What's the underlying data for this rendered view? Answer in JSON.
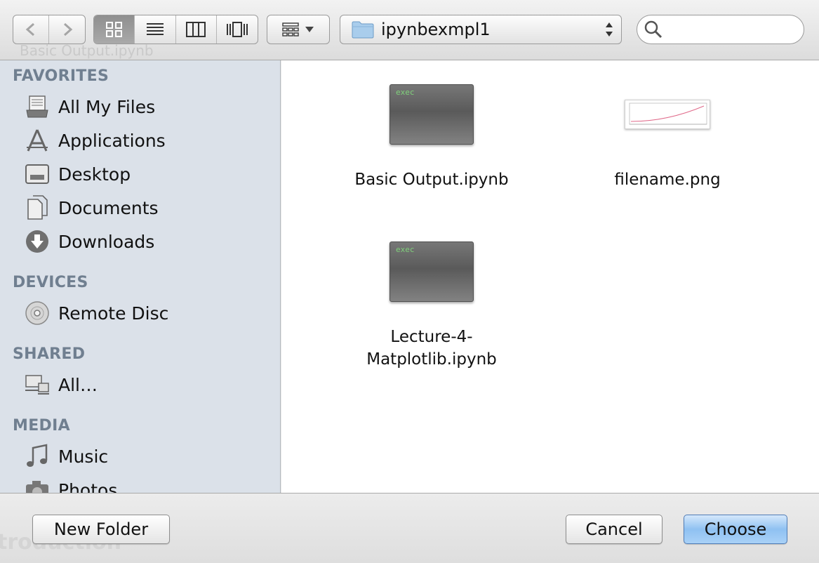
{
  "toolbar": {
    "ghost_text": "Basic Output.ipynb",
    "path_label": "ipynbexmpl1",
    "search_placeholder": ""
  },
  "sidebar": {
    "sections": {
      "favorites": "FAVORITES",
      "devices": "DEVICES",
      "shared": "SHARED",
      "media": "MEDIA"
    },
    "favorites": [
      {
        "label": "All My Files",
        "icon": "all-files-icon"
      },
      {
        "label": "Applications",
        "icon": "applications-icon"
      },
      {
        "label": "Desktop",
        "icon": "desktop-icon"
      },
      {
        "label": "Documents",
        "icon": "documents-icon"
      },
      {
        "label": "Downloads",
        "icon": "downloads-icon"
      }
    ],
    "devices": [
      {
        "label": "Remote Disc",
        "icon": "disc-icon"
      }
    ],
    "shared": [
      {
        "label": "All…",
        "icon": "network-icon"
      }
    ],
    "media": [
      {
        "label": "Music",
        "icon": "music-icon"
      },
      {
        "label": "Photos",
        "icon": "camera-icon"
      }
    ]
  },
  "files": [
    {
      "name": "Basic Output.ipynb",
      "thumb_text": "exec"
    },
    {
      "name": "filename.png"
    },
    {
      "name_line1": "Lecture-4-",
      "name_line2": "Matplotlib.ipynb",
      "thumb_text": "exec"
    }
  ],
  "bottom": {
    "ghost_text": "troduction",
    "new_folder": "New Folder",
    "cancel": "Cancel",
    "choose": "Choose"
  }
}
